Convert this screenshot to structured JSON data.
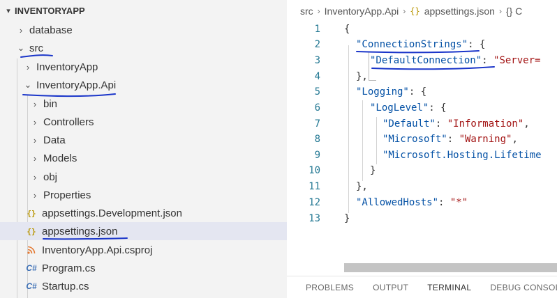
{
  "explorer": {
    "title": "INVENTORYAPP",
    "items": [
      {
        "label": "database",
        "kind": "folder",
        "expanded": false
      },
      {
        "label": "src",
        "kind": "folder",
        "expanded": true
      },
      {
        "label": "InventoryApp",
        "kind": "folder",
        "expanded": false
      },
      {
        "label": "InventoryApp.Api",
        "kind": "folder",
        "expanded": true
      },
      {
        "label": "bin",
        "kind": "folder",
        "expanded": false
      },
      {
        "label": "Controllers",
        "kind": "folder",
        "expanded": false
      },
      {
        "label": "Data",
        "kind": "folder",
        "expanded": false
      },
      {
        "label": "Models",
        "kind": "folder",
        "expanded": false
      },
      {
        "label": "obj",
        "kind": "folder",
        "expanded": false
      },
      {
        "label": "Properties",
        "kind": "folder",
        "expanded": false
      },
      {
        "label": "appsettings.Development.json",
        "kind": "json"
      },
      {
        "label": "appsettings.json",
        "kind": "json",
        "selected": true
      },
      {
        "label": "InventoryApp.Api.csproj",
        "kind": "csproj"
      },
      {
        "label": "Program.cs",
        "kind": "cs"
      },
      {
        "label": "Startup.cs",
        "kind": "cs"
      }
    ]
  },
  "icons": {
    "chevron_right": "›",
    "chevron_down": "⌄",
    "json": "{}",
    "rss": "ͱ",
    "cs": "C#"
  },
  "editor": {
    "breadcrumb": {
      "part1": "src",
      "part2": "InventoryApp.Api",
      "part3": "appsettings.json",
      "part4": "{} C"
    },
    "lines": [
      {
        "n": "1"
      },
      {
        "n": "2"
      },
      {
        "n": "3"
      },
      {
        "n": "4"
      },
      {
        "n": "5"
      },
      {
        "n": "6"
      },
      {
        "n": "7"
      },
      {
        "n": "8"
      },
      {
        "n": "9"
      },
      {
        "n": "10"
      },
      {
        "n": "11"
      },
      {
        "n": "12"
      },
      {
        "n": "13"
      }
    ],
    "code": {
      "l1": "{",
      "l2_key": "\"ConnectionStrings\"",
      "l2_rest": ": {",
      "l3_key": "\"DefaultConnection\"",
      "l3_colon": ": ",
      "l3_val": "\"Server=",
      "l4": "},",
      "l5_key": "\"Logging\"",
      "l5_rest": ": {",
      "l6_key": "\"LogLevel\"",
      "l6_rest": ": {",
      "l7_key": "\"Default\"",
      "l7_colon": ": ",
      "l7_val": "\"Information\"",
      "l7_end": ",",
      "l8_key": "\"Microsoft\"",
      "l8_colon": ": ",
      "l8_val": "\"Warning\"",
      "l8_end": ",",
      "l9_key": "\"Microsoft.Hosting.Lifetime",
      "l10": "}",
      "l11": "},",
      "l12_key": "\"AllowedHosts\"",
      "l12_colon": ": ",
      "l12_val": "\"*\"",
      "l13": "}"
    }
  },
  "panel": {
    "tabs": [
      "PROBLEMS",
      "OUTPUT",
      "TERMINAL",
      "DEBUG CONSOLE"
    ],
    "active": "TERMINAL"
  },
  "colors": {
    "annotation": "#1a35c9",
    "json_key": "#0451a5",
    "json_string": "#a31515",
    "line_number": "#237893",
    "selection": "#e4e6f1"
  }
}
